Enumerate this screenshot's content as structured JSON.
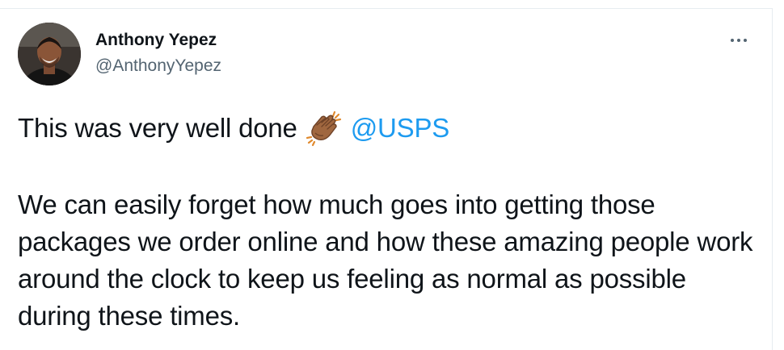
{
  "tweet": {
    "author": {
      "display_name": "Anthony Yepez",
      "handle": "@AnthonyYepez",
      "avatar_icon": "profile-photo"
    },
    "more_icon": "ellipsis-icon",
    "line1_text": "This was very well done",
    "emoji_icon": "clapping-hands-icon",
    "mention": "@USPS",
    "paragraph2": "We can easily forget how much goes into getting those packages we order online and how these amazing people work around the clock to keep us feeling as normal as possible during these times."
  },
  "colors": {
    "text": "#0f1419",
    "secondary": "#536471",
    "link": "#1d9bf0",
    "border": "#e6ecf0"
  }
}
